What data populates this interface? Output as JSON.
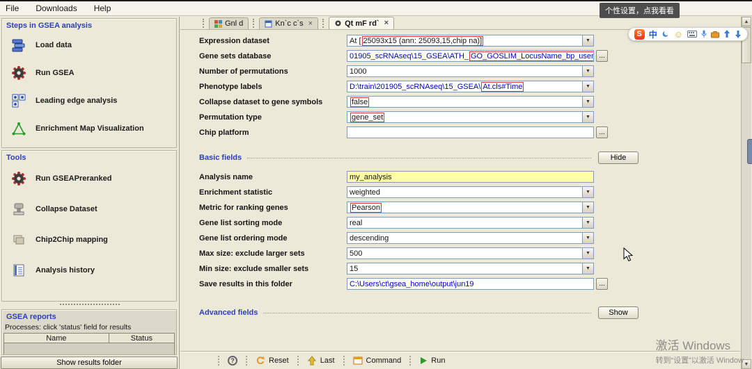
{
  "glyphs": {
    "combo_arrow": "▼",
    "ellipsis": "...",
    "close": "×",
    "scroll_up": "▲",
    "scroll_down": "▼"
  },
  "menu": {
    "items": [
      "File",
      "Downloads",
      "Help"
    ]
  },
  "sidebar": {
    "steps": {
      "title": "Steps in GSEA analysis",
      "items": [
        {
          "label": "Load data"
        },
        {
          "label": "Run GSEA"
        },
        {
          "label": "Leading edge analysis"
        },
        {
          "label": "Enrichment Map Visualization"
        }
      ]
    },
    "tools": {
      "title": "Tools",
      "items": [
        {
          "label": "Run GSEAPreranked"
        },
        {
          "label": "Collapse Dataset"
        },
        {
          "label": "Chip2Chip mapping"
        },
        {
          "label": "Analysis history"
        }
      ]
    },
    "reports": {
      "title": "GSEA reports",
      "note": "Processes: click 'status' field for results",
      "columns": [
        "Name",
        "Status"
      ],
      "show_results_button": "Show results folder"
    }
  },
  "tabs": [
    {
      "label": "Gnl d"
    },
    {
      "label": "Kn`c c`s"
    },
    {
      "label": "Qt mF rd`"
    }
  ],
  "form": {
    "fields": [
      {
        "label": "Expression dataset",
        "value_pre": "At [",
        "value_red": "25093x15 (ann: 25093,15,chip na)]",
        "value_post": ""
      },
      {
        "label": "Gene sets database",
        "value_pre": "01905_scRNAseq\\15_GSEA\\ATH_",
        "value_red": "GO_GOSLIM_LocusName_bp_usem",
        "value_post": "e.gmt"
      },
      {
        "label": "Number of permutations",
        "value_pre": "1000",
        "value_red": "",
        "value_post": ""
      },
      {
        "label": "Phenotype labels",
        "value_pre": "D:\\train\\201905_scRNAseq\\15_GSEA\\",
        "value_red": "At.cls#Time",
        "value_post": ""
      },
      {
        "label": "Collapse dataset to gene symbols",
        "value_pre": "",
        "value_red": "false",
        "value_post": ""
      },
      {
        "label": "Permutation type",
        "value_pre": "",
        "value_red": "gene_set",
        "value_post": ""
      },
      {
        "label": "Chip platform",
        "value_pre": "",
        "value_red": "",
        "value_post": ""
      }
    ],
    "basic": {
      "title": "Basic fields",
      "hide_button": "Hide",
      "fields": [
        {
          "label": "Analysis name",
          "value_pre": "my_analysis",
          "value_red": "",
          "value_post": ""
        },
        {
          "label": "Enrichment statistic",
          "value_pre": "weighted",
          "value_red": "",
          "value_post": ""
        },
        {
          "label": "Metric for ranking genes",
          "value_pre": "",
          "value_red": "Pearson",
          "value_post": ""
        },
        {
          "label": "Gene list sorting mode",
          "value_pre": "real",
          "value_red": "",
          "value_post": ""
        },
        {
          "label": "Gene list ordering mode",
          "value_pre": "descending",
          "value_red": "",
          "value_post": ""
        },
        {
          "label": "Max size: exclude larger sets",
          "value_pre": "500",
          "value_red": "",
          "value_post": ""
        },
        {
          "label": "Min size: exclude smaller sets",
          "value_pre": "15",
          "value_red": "",
          "value_post": ""
        },
        {
          "label": "Save results in this folder",
          "value_pre": "C:\\Users\\ct\\gsea_home\\output\\jun19",
          "value_red": "",
          "value_post": ""
        }
      ]
    },
    "advanced": {
      "title": "Advanced fields",
      "show_button": "Show"
    }
  },
  "toolbar": {
    "help_glyph": "?",
    "reset": "Reset",
    "last": "Last",
    "command": "Command",
    "run": "Run"
  },
  "ime": {
    "tooltip": "个性设置，点我看看",
    "logo_glyph": "S",
    "mode_glyph": "中",
    "smiley_glyph": "☺"
  },
  "watermark": {
    "line1": "激活 Windows",
    "line2": "转到“设置”以激活 Window"
  }
}
